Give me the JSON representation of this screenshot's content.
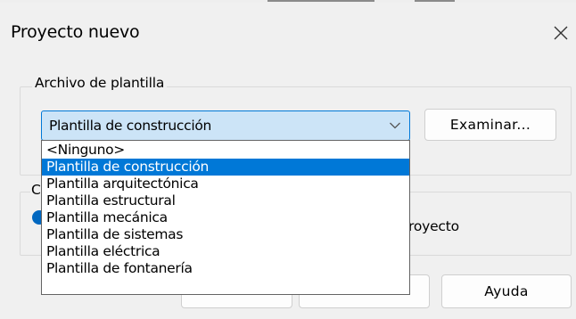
{
  "dialog": {
    "title": "Proyecto nuevo"
  },
  "template_group": {
    "label": "Archivo de plantilla",
    "combo": {
      "value": "Plantilla de construcción"
    },
    "browse_label": "Examinar..."
  },
  "create_group": {
    "label_visible": "C",
    "radio_label_visible": "royecto"
  },
  "dropdown": {
    "items": [
      "<Ninguno>",
      "Plantilla de construcción",
      "Plantilla arquitectónica",
      "Plantilla estructural",
      "Plantilla mecánica",
      "Plantilla de sistemas",
      "Plantilla eléctrica",
      "Plantilla de fontanería"
    ],
    "selected_index": 1
  },
  "footer": {
    "help_label": "Ayuda"
  },
  "colors": {
    "accent": "#0078d7",
    "combo_bg": "#cce4f7",
    "dialog_bg": "#f0f0f0"
  },
  "icons": {
    "close": "close-icon",
    "combo_arrow": "chevron-down-icon",
    "radio": "radio-selected-icon"
  }
}
